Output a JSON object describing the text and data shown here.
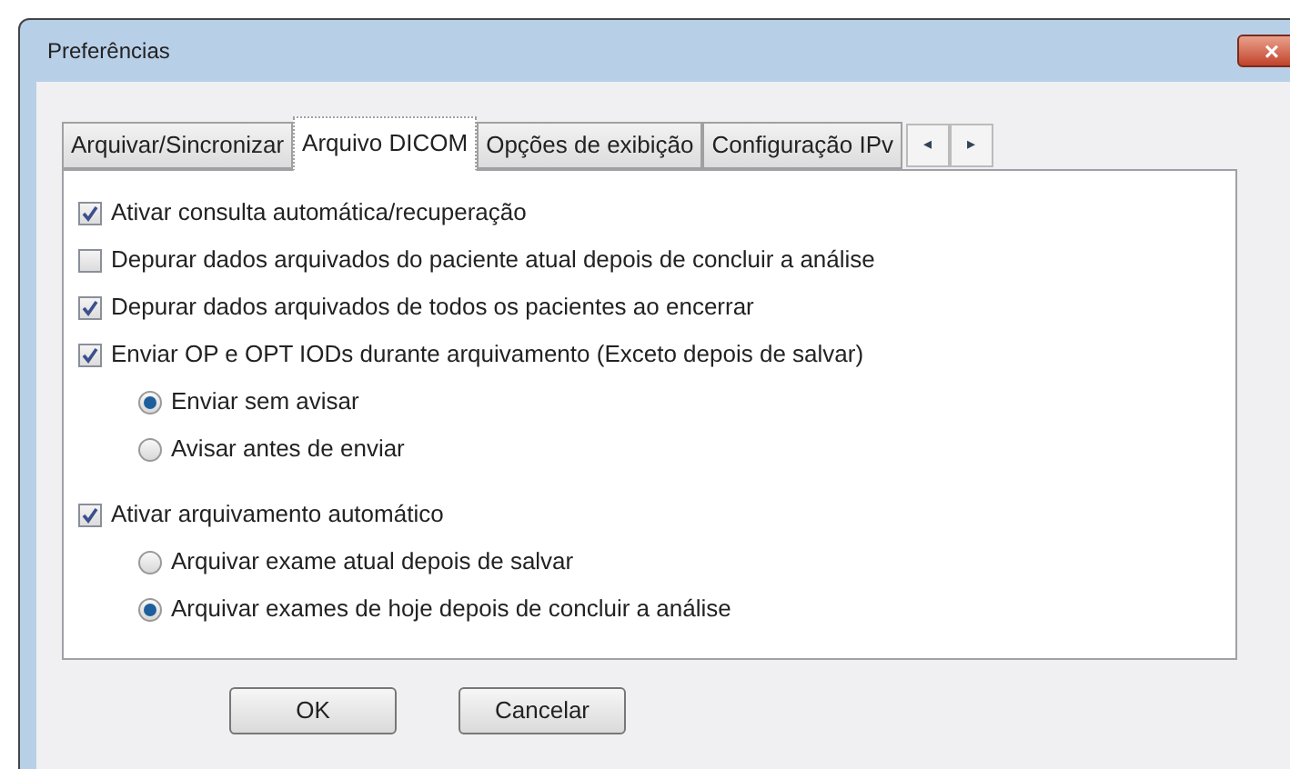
{
  "window": {
    "title": "Preferências",
    "close": "×"
  },
  "tabs": [
    {
      "label": "Arquivar/Sincronizar",
      "selected": false
    },
    {
      "label": "Arquivo DICOM",
      "selected": true
    },
    {
      "label": "Opções de exibição",
      "selected": false
    },
    {
      "label": "Configuração IPv",
      "selected": false
    }
  ],
  "tab_scroll": [
    "◂",
    "▸"
  ],
  "options": [
    {
      "kind": "checkbox",
      "label": "Ativar consulta automática/recuperação",
      "checked": true
    },
    {
      "kind": "checkbox",
      "label": "Depurar dados arquivados do paciente atual depois de concluir a análise",
      "checked": false
    },
    {
      "kind": "checkbox",
      "label": "Depurar dados arquivados de todos os pacientes ao encerrar",
      "checked": true
    },
    {
      "kind": "checkbox",
      "label": "Enviar OP e OPT IODs durante arquivamento (Exceto depois de salvar)",
      "checked": true,
      "children": [
        {
          "kind": "radio",
          "label": "Enviar sem avisar",
          "selected": true
        },
        {
          "kind": "radio",
          "label": "Avisar antes de enviar",
          "selected": false
        }
      ]
    },
    {
      "kind": "checkbox",
      "label": "Ativar arquivamento automático",
      "checked": true,
      "children": [
        {
          "kind": "radio",
          "label": "Arquivar exame atual depois de salvar",
          "selected": false
        },
        {
          "kind": "radio",
          "label": "Arquivar exames de hoje depois de concluir a análise",
          "selected": true
        }
      ]
    }
  ],
  "buttons": [
    "OK",
    "Cancelar"
  ]
}
